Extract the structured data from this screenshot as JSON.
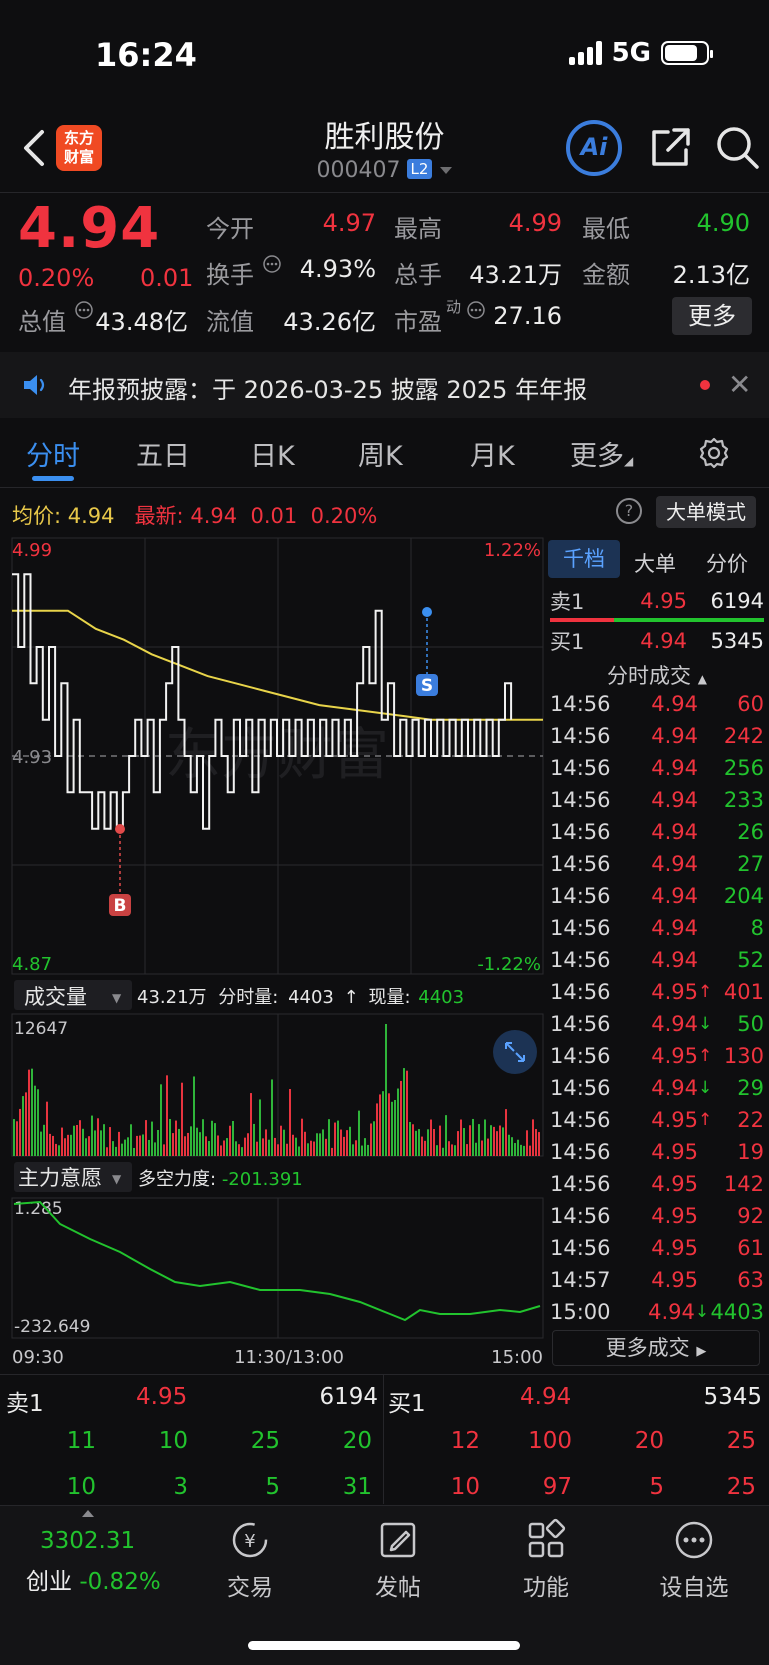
{
  "status": {
    "time": "16:24",
    "network": "5G"
  },
  "header": {
    "logo_line1": "东方",
    "logo_line2": "财富",
    "name": "胜利股份",
    "code": "000407",
    "level_badge": "L2",
    "ai_label": "Ai"
  },
  "quote": {
    "price": "4.94",
    "pct": "0.20%",
    "chg": "0.01",
    "open_label": "今开",
    "open": "4.97",
    "high_label": "最高",
    "high": "4.99",
    "low_label": "最低",
    "low": "4.90",
    "turnover_label": "换手",
    "turnover": "4.93%",
    "volume_label": "总手",
    "volume": "43.21万",
    "amount_label": "金额",
    "amount": "2.13亿",
    "mktcap_label": "总值",
    "mktcap": "43.48亿",
    "float_label": "流值",
    "float": "43.26亿",
    "pe_label": "市盈",
    "pe_sup": "动",
    "pe": "27.16",
    "more_label": "更多"
  },
  "notice": {
    "text": "年报预披露：于 2026-03-25 披露 2025 年年报"
  },
  "tabs": [
    "分时",
    "五日",
    "日K",
    "周K",
    "月K",
    "更多"
  ],
  "chart_info": {
    "avg_label": "均价:",
    "avg": "4.94",
    "last_label": "最新:",
    "last": "4.94",
    "chg": "0.01",
    "pct": "0.20%",
    "help": "?",
    "bigorder": "大单模式"
  },
  "chart_data": {
    "type": "line",
    "y_top": "4.99",
    "y_mid": "4.93",
    "y_bottom": "4.87",
    "pct_top": "1.22%",
    "pct_bottom": "-1.22%",
    "ylim": [
      4.87,
      4.99
    ],
    "price_series": [
      4.98,
      4.96,
      4.98,
      4.95,
      4.96,
      4.94,
      4.96,
      4.93,
      4.95,
      4.92,
      4.94,
      4.92,
      4.92,
      4.91,
      4.92,
      4.91,
      4.92,
      4.91,
      4.92,
      4.93,
      4.94,
      4.93,
      4.94,
      4.92,
      4.94,
      4.95,
      4.96,
      4.94,
      4.93,
      4.92,
      4.93,
      4.91,
      4.93,
      4.94,
      4.93,
      4.92,
      4.94,
      4.93,
      4.94,
      4.92,
      4.94,
      4.93,
      4.94,
      4.93,
      4.94,
      4.93,
      4.94,
      4.93,
      4.94,
      4.93,
      4.94,
      4.93,
      4.94,
      4.93,
      4.94,
      4.93,
      4.95,
      4.96,
      4.95,
      4.97,
      4.94,
      4.95,
      4.93,
      4.94,
      4.93,
      4.94,
      4.93,
      4.94,
      4.93,
      4.94,
      4.93,
      4.94,
      4.93,
      4.94,
      4.93,
      4.94,
      4.93,
      4.94,
      4.93,
      4.94,
      4.95,
      4.94
    ],
    "avg_series": [
      4.97,
      4.97,
      4.97,
      4.965,
      4.962,
      4.958,
      4.955,
      4.952,
      4.95,
      4.948,
      4.946,
      4.944,
      4.943,
      4.942,
      4.941,
      4.94,
      4.94,
      4.94,
      4.94,
      4.94
    ],
    "buy_marker": "B",
    "sell_marker": "S",
    "volume_label": "成交量",
    "volume_total": "43.21万",
    "tick_vol_label": "分时量:",
    "tick_vol": "4403",
    "now_vol_label": "现量:",
    "now_vol": "4403",
    "volume_max": "12647",
    "force_label": "主力意愿",
    "force_text_label": "多空力度:",
    "force_value": "-201.391",
    "force_top": "1.285",
    "force_bottom": "-232.649",
    "x_labels": [
      "09:30",
      "11:30/13:00",
      "15:00"
    ]
  },
  "right_panel": {
    "tabs": [
      "千档",
      "大单",
      "分价"
    ],
    "ask": {
      "label": "卖1",
      "price": "4.95",
      "vol": "6194"
    },
    "bid": {
      "label": "买1",
      "price": "4.94",
      "vol": "5345"
    },
    "sub_title": "分时成交",
    "ticks": [
      {
        "t": "14:56",
        "p": "4.94",
        "a": "",
        "v": "60",
        "pc": "red",
        "vc": "red"
      },
      {
        "t": "14:56",
        "p": "4.94",
        "a": "",
        "v": "242",
        "pc": "red",
        "vc": "red"
      },
      {
        "t": "14:56",
        "p": "4.94",
        "a": "",
        "v": "256",
        "pc": "red",
        "vc": "green"
      },
      {
        "t": "14:56",
        "p": "4.94",
        "a": "",
        "v": "233",
        "pc": "red",
        "vc": "green"
      },
      {
        "t": "14:56",
        "p": "4.94",
        "a": "",
        "v": "26",
        "pc": "red",
        "vc": "green"
      },
      {
        "t": "14:56",
        "p": "4.94",
        "a": "",
        "v": "27",
        "pc": "red",
        "vc": "green"
      },
      {
        "t": "14:56",
        "p": "4.94",
        "a": "",
        "v": "204",
        "pc": "red",
        "vc": "green"
      },
      {
        "t": "14:56",
        "p": "4.94",
        "a": "",
        "v": "8",
        "pc": "red",
        "vc": "green"
      },
      {
        "t": "14:56",
        "p": "4.94",
        "a": "",
        "v": "52",
        "pc": "red",
        "vc": "green"
      },
      {
        "t": "14:56",
        "p": "4.95",
        "a": "↑",
        "v": "401",
        "pc": "red",
        "vc": "red"
      },
      {
        "t": "14:56",
        "p": "4.94",
        "a": "↓",
        "v": "50",
        "pc": "red",
        "vc": "green"
      },
      {
        "t": "14:56",
        "p": "4.95",
        "a": "↑",
        "v": "130",
        "pc": "red",
        "vc": "red"
      },
      {
        "t": "14:56",
        "p": "4.94",
        "a": "↓",
        "v": "29",
        "pc": "red",
        "vc": "green"
      },
      {
        "t": "14:56",
        "p": "4.95",
        "a": "↑",
        "v": "22",
        "pc": "red",
        "vc": "red"
      },
      {
        "t": "14:56",
        "p": "4.95",
        "a": "",
        "v": "19",
        "pc": "red",
        "vc": "red"
      },
      {
        "t": "14:56",
        "p": "4.95",
        "a": "",
        "v": "142",
        "pc": "red",
        "vc": "red"
      },
      {
        "t": "14:56",
        "p": "4.95",
        "a": "",
        "v": "92",
        "pc": "red",
        "vc": "red"
      },
      {
        "t": "14:56",
        "p": "4.95",
        "a": "",
        "v": "61",
        "pc": "red",
        "vc": "red"
      },
      {
        "t": "14:57",
        "p": "4.95",
        "a": "",
        "v": "63",
        "pc": "red",
        "vc": "red"
      },
      {
        "t": "15:00",
        "p": "4.94",
        "a": "↓",
        "v": "4403",
        "pc": "red",
        "vc": "green"
      }
    ],
    "more_trades": "更多成交"
  },
  "orderbook": {
    "ask_label": "卖1",
    "ask_price": "4.95",
    "ask_vol": "6194",
    "bid_label": "买1",
    "bid_price": "4.94",
    "bid_vol": "5345",
    "ask_row1": [
      "11",
      "10",
      "25",
      "20"
    ],
    "ask_row2": [
      "10",
      "3",
      "5",
      "31"
    ],
    "bid_row1": [
      "12",
      "100",
      "20",
      "25"
    ],
    "bid_row2": [
      "10",
      "97",
      "5",
      "25"
    ]
  },
  "bottom_nav": {
    "index_value": "3302.31",
    "index_name": "创业",
    "index_pct": "-0.82%",
    "items": [
      "交易",
      "发帖",
      "功能",
      "设自选"
    ]
  }
}
